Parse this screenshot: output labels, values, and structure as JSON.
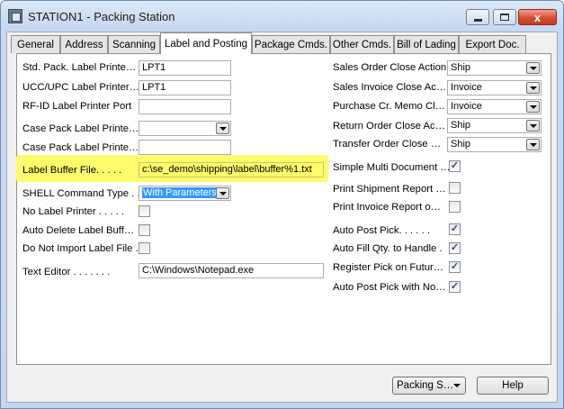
{
  "window": {
    "title": "STATION1 - Packing Station",
    "close_glyph": "x"
  },
  "tabs": [
    {
      "label": "General"
    },
    {
      "label": "Address"
    },
    {
      "label": "Scanning"
    },
    {
      "label": "Label and Posting",
      "active": true
    },
    {
      "label": "Package Cmds."
    },
    {
      "label": "Other Cmds."
    },
    {
      "label": "Bill of Lading"
    },
    {
      "label": "Export Doc."
    }
  ],
  "left_fields": {
    "std_pack_label": {
      "label": "Std. Pack. Label Printe…",
      "value": "LPT1"
    },
    "ucc_upc_label": {
      "label": "UCC/UPC Label Printer…",
      "value": "LPT1"
    },
    "rfid_port": {
      "label": "RF-ID Label Printer Port",
      "value": ""
    },
    "case_pack_label_1": {
      "label": "Case Pack Label Printe…",
      "value": ""
    },
    "case_pack_label_2": {
      "label": "Case Pack Label Printe…",
      "value": ""
    },
    "label_buffer_file": {
      "label": "Label Buffer File. . . . .",
      "value": "c:\\se_demo\\shipping\\label\\buffer%1.txt"
    },
    "shell_command_type": {
      "label": "SHELL Command Type . .",
      "value": "With Parameters"
    },
    "no_label_printer": {
      "label": "No Label Printer . . . . .",
      "checked": false
    },
    "auto_delete_label_buffer": {
      "label": "Auto Delete Label Buff…",
      "checked": false
    },
    "do_not_import_label_file": {
      "label": "Do Not Import Label File .",
      "checked": false
    },
    "text_editor": {
      "label": "Text Editor . . . . . . .",
      "value": "C:\\Windows\\Notepad.exe"
    }
  },
  "right_fields": {
    "sales_order_close_action": {
      "label": "Sales Order Close Action.",
      "value": "Ship"
    },
    "sales_invoice_close_action": {
      "label": "Sales Invoice Close Ac…",
      "value": "Invoice"
    },
    "purchase_cr_memo_close": {
      "label": "Purchase Cr. Memo Cl…",
      "value": "Invoice"
    },
    "return_order_close_action": {
      "label": "Return Order Close Ac…",
      "value": "Ship"
    },
    "transfer_order_close": {
      "label": "Transfer Order Close …",
      "value": "Ship"
    },
    "simple_multi_document": {
      "label": "Simple Multi Document …",
      "checked": true
    },
    "print_shipment_report": {
      "label": "Print Shipment Report …",
      "checked": false
    },
    "print_invoice_report": {
      "label": "Print Invoice Report o…",
      "checked": false
    },
    "auto_post_pick": {
      "label": "Auto Post Pick. . . . . .",
      "checked": true
    },
    "auto_fill_qty": {
      "label": "Auto Fill Qty. to Handle .",
      "checked": true
    },
    "register_pick_on_future": {
      "label": "Register Pick on Futur…",
      "checked": true
    },
    "auto_post_pick_with_no": {
      "label": "Auto Post Pick with No…",
      "checked": true
    }
  },
  "buttons": {
    "packing_station_menu": "Packing S…",
    "help": "Help"
  },
  "colors": {
    "highlight": "#fffb6a",
    "selection": "#3399ff",
    "title_bar": "#c6d9ef"
  }
}
